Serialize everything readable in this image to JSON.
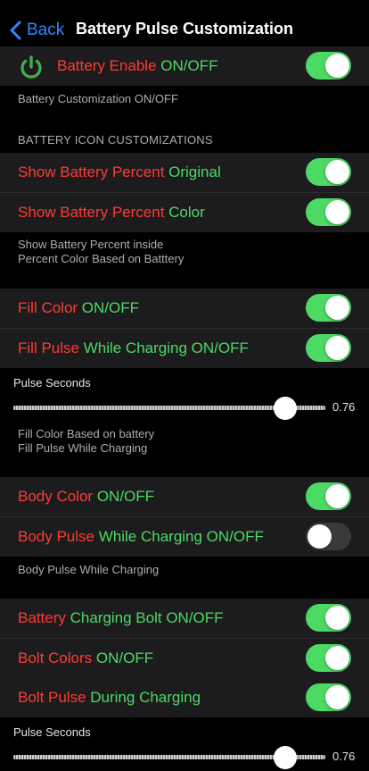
{
  "nav": {
    "back_label": "Back",
    "title": "Battery Pulse Customization"
  },
  "colors": {
    "switch_on": "#4cd964",
    "label_red": "#ff3b30",
    "label_green": "#4cd964",
    "back_blue": "#2f86ff"
  },
  "battery_enable": {
    "label_a": "Battery Enable ",
    "label_b": "ON/OFF",
    "on": true,
    "icon": "power-icon"
  },
  "battery_footer": "Battery Customization ON/OFF",
  "icon_section": {
    "header": "BATTERY ICON CUSTOMIZATIONS",
    "show_percent_original": {
      "label_a": "Show Battery Percent ",
      "label_b": "Original",
      "on": true
    },
    "show_percent_color": {
      "label_a": "Show Battery Percent ",
      "label_b": "Color",
      "on": true
    },
    "footer_line1": "Show Battery Percent inside",
    "footer_line2": "Percent Color Based on Batttery"
  },
  "fill_section": {
    "fill_color": {
      "label_a": "Fill Color ",
      "label_b": "ON/OFF",
      "on": true
    },
    "fill_pulse": {
      "label_a": "Fill Pulse ",
      "label_b": "While Charging ON/OFF",
      "on": true
    },
    "slider_label": "Pulse Seconds",
    "slider_value": "0.76",
    "slider_fraction": 0.87,
    "footer_line1": "Fill Color Based on battery",
    "footer_line2": "Fill Pulse While Charging"
  },
  "body_section": {
    "body_color": {
      "label_a": "Body Color ",
      "label_b": "ON/OFF",
      "on": true
    },
    "body_pulse": {
      "label_a": "Body Pulse ",
      "label_b": "While Charging ON/OFF",
      "on": false
    },
    "footer": "Body Pulse While Charging"
  },
  "bolt_section": {
    "charging_bolt": {
      "label_a": "Battery ",
      "label_b": "Charging Bolt ON/OFF",
      "on": true
    },
    "bolt_colors": {
      "label_a": "Bolt Colors ",
      "label_b": "ON/OFF",
      "on": true
    },
    "bolt_pulse": {
      "label_a": "Bolt Pulse ",
      "label_b": "During Charging",
      "on": true
    },
    "slider_label": "Pulse Seconds",
    "slider_value": "0.76",
    "slider_fraction": 0.87
  }
}
